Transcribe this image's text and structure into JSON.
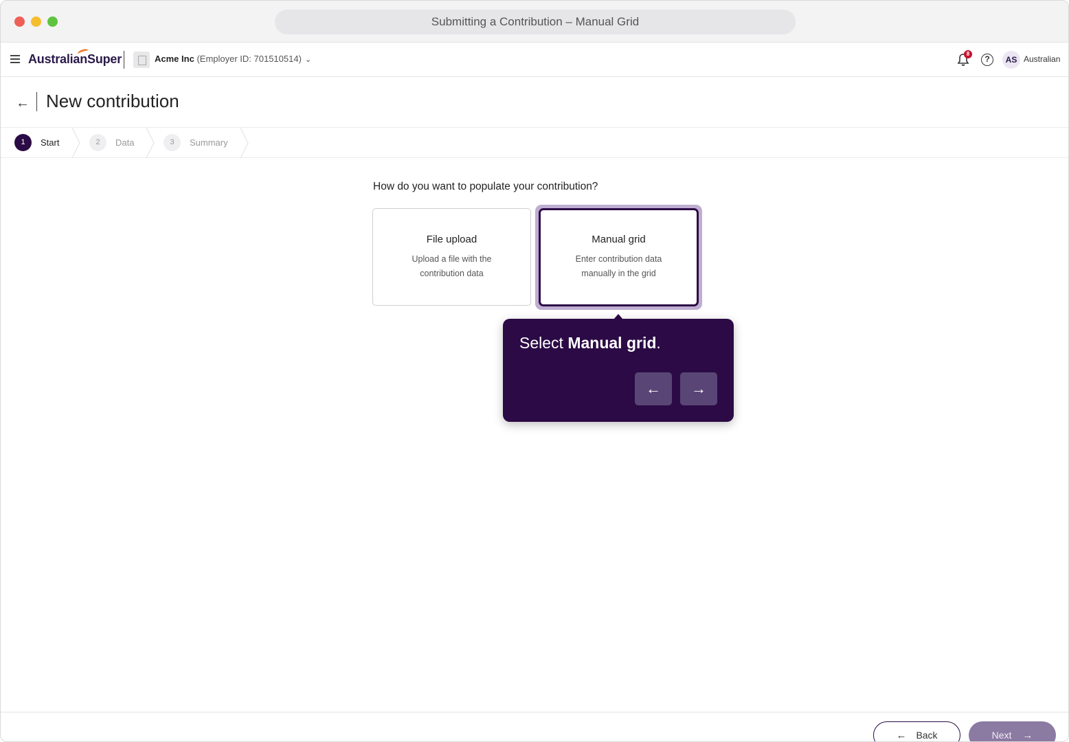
{
  "window": {
    "title": "Submitting a Contribution – Manual Grid"
  },
  "header": {
    "logo_text": "AustralianSuper",
    "employer_name": "Acme Inc",
    "employer_id": "(Employer ID: 701510514)",
    "notification_count": "8",
    "help_glyph": "?",
    "avatar_initials": "AS",
    "user_name": "Australian"
  },
  "page": {
    "title": "New contribution"
  },
  "stepper": {
    "steps": [
      {
        "number": "1",
        "label": "Start"
      },
      {
        "number": "2",
        "label": "Data"
      },
      {
        "number": "3",
        "label": "Summary"
      }
    ]
  },
  "main": {
    "question": "How do you want to populate your contribution?",
    "options": [
      {
        "title": "File upload",
        "description": "Upload a file with the contribution data"
      },
      {
        "title": "Manual grid",
        "description": "Enter contribution data manually in the grid"
      }
    ]
  },
  "tooltip": {
    "prefix": "Select ",
    "highlight": "Manual grid",
    "suffix": "."
  },
  "footer": {
    "back_label": "Back",
    "next_label": "Next"
  },
  "colors": {
    "brand_purple": "#2b0a45",
    "accent_orange": "#f07a2a",
    "badge_red": "#c8102e"
  }
}
